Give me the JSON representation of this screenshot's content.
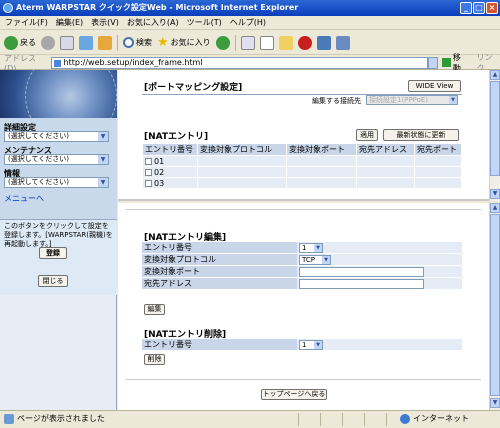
{
  "window": {
    "title": "Aterm WARPSTAR クイック設定Web - Microsoft Internet Explorer"
  },
  "menu": [
    "ファイル(F)",
    "編集(E)",
    "表示(V)",
    "お気に入り(A)",
    "ツール(T)",
    "ヘルプ(H)"
  ],
  "toolbar": {
    "back": "戻る",
    "search": "検索",
    "favorites": "お気に入り"
  },
  "address": {
    "label": "アドレス(D)",
    "url": "http://web.setup/index_frame.html",
    "go": "移動",
    "links": "リンク"
  },
  "sidebar": {
    "detail_label": "詳細設定",
    "detail_select": "(選択してください)",
    "maint_label": "メンテナンス",
    "maint_select": "(選択してください)",
    "info_label": "情報",
    "info_select": "(選択してください)",
    "menu_link": "メニューへ",
    "info_text": "このボタンをクリックして設定を登録します。[WARPSTAR(親機)を再起動します。]",
    "register": "登録",
    "close": "閉じる"
  },
  "top": {
    "title": "[ポートマッピング設定]",
    "wide_view": "WIDE View",
    "target_label": "編集する接続先",
    "target_value": "接続設定1(PPPoE)",
    "nat_title": "[NATエントリ]",
    "apply": "適用",
    "refresh": "最新状態に更新",
    "columns": [
      "エントリ番号",
      "変換対象プロトコル",
      "変換対象ポート",
      "宛先アドレス",
      "宛先ポート"
    ],
    "rows": [
      "01",
      "02",
      "03"
    ]
  },
  "edit": {
    "title": "[NATエントリ編集]",
    "entry_label": "エントリ番号",
    "entry_value": "1",
    "proto_label": "変換対象プロトコル",
    "proto_value": "TCP",
    "port_label": "変換対象ポート",
    "dest_label": "宛先アドレス",
    "edit_btn": "編集"
  },
  "del": {
    "title": "[NATエントリ削除]",
    "entry_label": "エントリ番号",
    "entry_value": "1",
    "del_btn": "削除"
  },
  "footer": {
    "top_page": "トップページへ戻る"
  },
  "status": {
    "left": "ページが表示されました",
    "zone": "インターネット"
  }
}
